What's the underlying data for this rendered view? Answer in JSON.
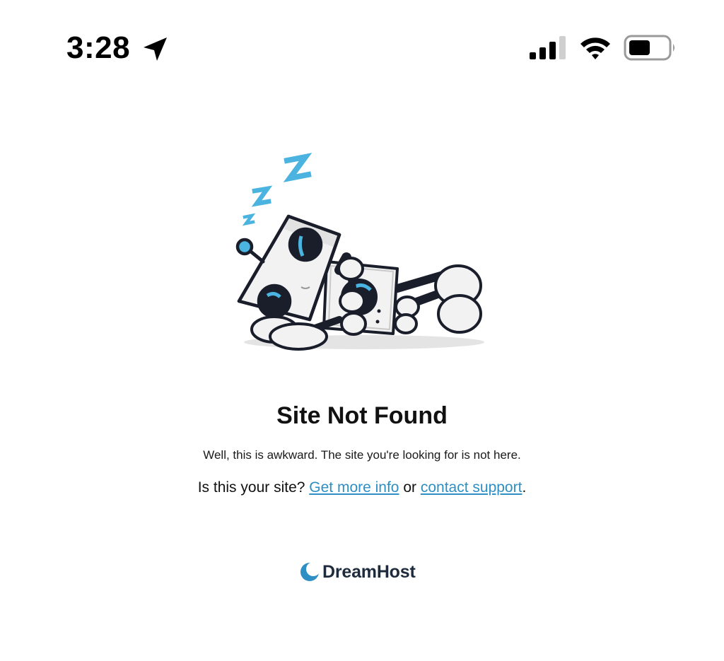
{
  "status_bar": {
    "time": "3:28",
    "icons": [
      "location-arrow-icon",
      "cellular-signal-icon",
      "wifi-icon",
      "battery-icon"
    ]
  },
  "illustration": {
    "name": "sleeping-robot-illustration",
    "sleep_letters": [
      "Z",
      "Z",
      "z"
    ]
  },
  "main": {
    "title": "Site Not Found",
    "message": "Well, this is awkward. The site you're looking for is not here.",
    "ownership_prefix": "Is this your site? ",
    "more_info_link": "Get more info",
    "ownership_middle": " or ",
    "support_link": "contact support",
    "ownership_suffix": "."
  },
  "footer": {
    "brand_name": "DreamHost",
    "brand_mark_icon": "dreamhost-moon-icon"
  },
  "colors": {
    "link": "#2d8fc4",
    "accent": "#4ab3e0",
    "brand_text": "#1e2b3c",
    "robot_outline": "#1a1e2b"
  }
}
